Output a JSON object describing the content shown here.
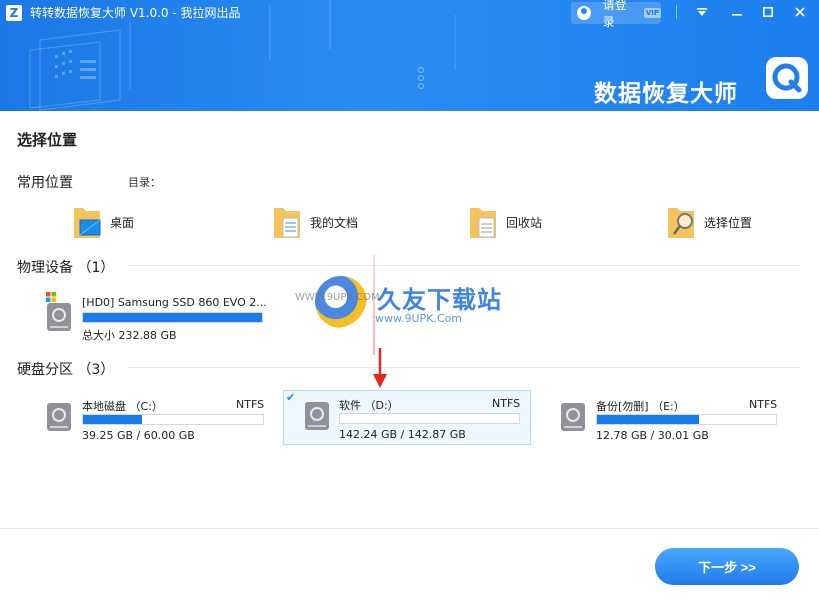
{
  "header": {
    "title": "转转数据恢复大师 V1.0.0 - 我拉网出品",
    "logo_letter": "Z",
    "login_label": "请登录",
    "vip_label": "VIP",
    "brand_text": "数据恢复大师"
  },
  "select": {
    "title": "选择位置"
  },
  "common": {
    "title": "常用位置",
    "dir_label": "目录：",
    "items": [
      {
        "label": "桌面",
        "icon": "desktop-folder-icon"
      },
      {
        "label": "我的文档",
        "icon": "documents-folder-icon"
      },
      {
        "label": "回收站",
        "icon": "recycle-folder-icon"
      },
      {
        "label": "选择位置",
        "icon": "search-folder-icon"
      }
    ]
  },
  "physical": {
    "title": "物理设备 （1）",
    "devices": [
      {
        "name": "[HD0] Samsung SSD 860 EVO 2...",
        "size": "总大小 232.88 GB",
        "used_fraction": 1.0
      }
    ]
  },
  "partitions": {
    "title": "硬盘分区 （3）",
    "items": [
      {
        "name": "本地磁盘 （C:）",
        "fs": "NTFS",
        "size": "39.25 GB / 60.00 GB",
        "used_fraction": 0.33,
        "selected": false
      },
      {
        "name": "软件 （D:）",
        "fs": "NTFS",
        "size": "142.24 GB / 142.87 GB",
        "used_fraction": 0.0,
        "selected": true
      },
      {
        "name": "备份[勿删] （E:）",
        "fs": "NTFS",
        "size": "12.78 GB / 30.01 GB",
        "used_fraction": 0.57,
        "selected": false
      }
    ]
  },
  "footer": {
    "next_label": "下一步 >>"
  },
  "watermark": {
    "title": "久友下载站",
    "url": "www.9UPK.Com",
    "left": "WWW.9UPK.COM"
  },
  "colors": {
    "accent": "#1a7bea",
    "header": "#2a8cf2"
  }
}
